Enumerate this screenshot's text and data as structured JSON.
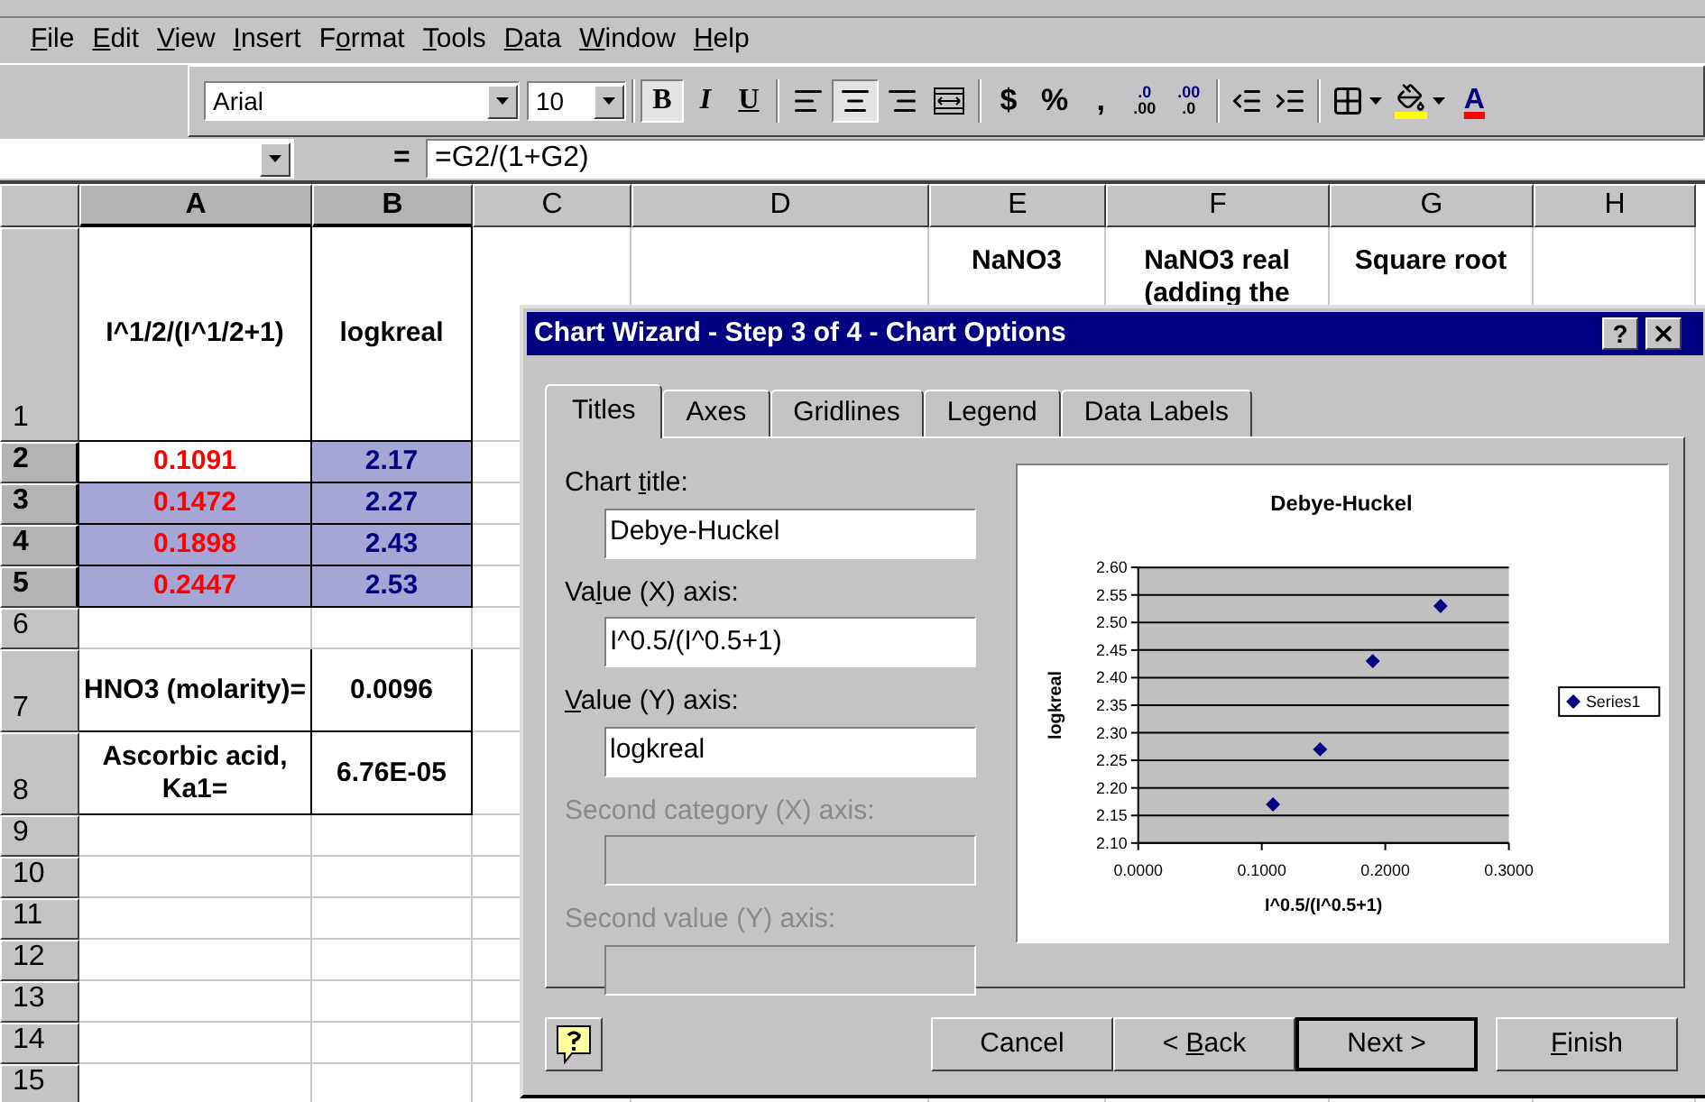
{
  "menu": [
    {
      "key": "F",
      "post": "ile"
    },
    {
      "key": "E",
      "post": "dit"
    },
    {
      "key": "V",
      "post": "iew"
    },
    {
      "key": "I",
      "post": "nsert"
    },
    {
      "pre": "F",
      "key": "o",
      "post": "rmat"
    },
    {
      "key": "T",
      "post": "ools"
    },
    {
      "key": "D",
      "post": "ata"
    },
    {
      "key": "W",
      "post": "indow"
    },
    {
      "key": "H",
      "post": "elp"
    }
  ],
  "toolbar": [
    {
      "kind": "font",
      "value": "Arial"
    },
    {
      "kind": "size",
      "value": "10"
    },
    {
      "kind": "sep"
    },
    {
      "kind": "bold",
      "label": "B",
      "selected": true
    },
    {
      "kind": "italic",
      "label": "I",
      "selected": false
    },
    {
      "kind": "underline",
      "label": "U",
      "selected": false
    },
    {
      "kind": "sep"
    },
    {
      "kind": "align-left",
      "selected": false
    },
    {
      "kind": "align-center",
      "selected": true
    },
    {
      "kind": "align-right",
      "selected": false
    },
    {
      "kind": "merge",
      "selected": false
    },
    {
      "kind": "sep"
    },
    {
      "kind": "symbol",
      "label": "$"
    },
    {
      "kind": "symbol",
      "label": "%"
    },
    {
      "kind": "symbol",
      "label": ","
    },
    {
      "kind": "decimal-up",
      "top": ".0",
      "bottom": ".00"
    },
    {
      "kind": "decimal-down",
      "top": ".00",
      "bottom": ".0"
    },
    {
      "kind": "sep"
    },
    {
      "kind": "indent-less"
    },
    {
      "kind": "indent-more"
    },
    {
      "kind": "sep"
    },
    {
      "kind": "borders"
    },
    {
      "kind": "fill"
    },
    {
      "kind": "font-color",
      "label": "A"
    }
  ],
  "formula_bar": {
    "equals": "=",
    "formula": "=G2/(1+G2)"
  },
  "sheet": {
    "columns": [
      {
        "label": "A",
        "selected": true
      },
      {
        "label": "B",
        "selected": true
      },
      {
        "label": "C",
        "selected": false
      },
      {
        "label": "D",
        "selected": false
      },
      {
        "label": "E",
        "selected": false
      },
      {
        "label": "F",
        "selected": false
      },
      {
        "label": "G",
        "selected": false
      },
      {
        "label": "H",
        "selected": false
      }
    ],
    "rows": [
      {
        "number": "1",
        "kind": "header",
        "selected": false,
        "cells": [
          {
            "text": "I^1/2/(I^1/2+1)",
            "boxed": true
          },
          {
            "text": "logkreal",
            "boxed": true
          },
          null,
          null,
          {
            "text": "NaNO3",
            "top": true
          },
          {
            "text": "NaNO3 real (adding the",
            "top": true
          },
          {
            "text": "Square root",
            "top": true
          },
          null
        ]
      },
      {
        "number": "2",
        "kind": "data",
        "selected": true,
        "cells": [
          {
            "text": "0.1091",
            "color": "#ff0000",
            "boxed": true,
            "selected": false
          },
          {
            "text": "2.17",
            "color": "#000080",
            "boxed": true,
            "selected": true
          },
          null,
          null,
          null,
          null,
          null,
          null
        ]
      },
      {
        "number": "3",
        "kind": "data",
        "selected": true,
        "cells": [
          {
            "text": "0.1472",
            "color": "#ff0000",
            "boxed": true,
            "selected": true
          },
          {
            "text": "2.27",
            "color": "#000080",
            "boxed": true,
            "selected": true
          },
          null,
          null,
          null,
          null,
          null,
          null
        ]
      },
      {
        "number": "4",
        "kind": "data",
        "selected": true,
        "cells": [
          {
            "text": "0.1898",
            "color": "#ff0000",
            "boxed": true,
            "selected": true
          },
          {
            "text": "2.43",
            "color": "#000080",
            "boxed": true,
            "selected": true
          },
          null,
          null,
          null,
          null,
          null,
          null
        ]
      },
      {
        "number": "5",
        "kind": "data",
        "selected": true,
        "cells": [
          {
            "text": "0.2447",
            "color": "#ff0000",
            "boxed": true,
            "selected": true
          },
          {
            "text": "2.53",
            "color": "#000080",
            "boxed": true,
            "selected": true
          },
          null,
          null,
          null,
          null,
          null,
          null
        ]
      },
      {
        "number": "6",
        "kind": "data",
        "selected": false,
        "cells": []
      },
      {
        "number": "7",
        "kind": "double",
        "selected": false,
        "cells": [
          {
            "text": "HNO3 (molarity)=",
            "boxed": true
          },
          {
            "text": "0.0096",
            "boxed": true
          }
        ]
      },
      {
        "number": "8",
        "kind": "double",
        "selected": false,
        "cells": [
          {
            "text": "Ascorbic acid, Ka1=",
            "boxed": true
          },
          {
            "text": "6.76E-05",
            "boxed": true
          }
        ]
      },
      {
        "number": "9",
        "kind": "data",
        "selected": false,
        "cells": []
      },
      {
        "number": "10",
        "kind": "data",
        "selected": false,
        "cells": []
      },
      {
        "number": "11",
        "kind": "data",
        "selected": false,
        "cells": []
      },
      {
        "number": "12",
        "kind": "data",
        "selected": false,
        "cells": []
      },
      {
        "number": "13",
        "kind": "data",
        "selected": false,
        "cells": []
      },
      {
        "number": "14",
        "kind": "data",
        "selected": false,
        "cells": []
      },
      {
        "number": "15",
        "kind": "data",
        "selected": false,
        "cells": []
      }
    ]
  },
  "dialog": {
    "title": "Chart Wizard - Step 3 of 4 - Chart Options",
    "help": "?",
    "tabs": [
      {
        "label": "Titles",
        "selected": true
      },
      {
        "label": "Axes",
        "selected": false
      },
      {
        "label": "Gridlines",
        "selected": false
      },
      {
        "label": "Legend",
        "selected": false
      },
      {
        "label": "Data Labels",
        "selected": false
      }
    ],
    "fields": [
      {
        "label": {
          "pre": "Chart ",
          "key": "t",
          "post": "itle:"
        },
        "value": "Debye-Huckel",
        "disabled": false
      },
      {
        "label": {
          "pre": "Va",
          "key": "l",
          "post": "ue (X) axis:"
        },
        "value": "I^0.5/(I^0.5+1)",
        "disabled": false
      },
      {
        "label": {
          "key": "V",
          "post": "alue (Y) axis:"
        },
        "value": "logkreal",
        "disabled": false
      },
      {
        "label": {
          "pre": "Second category (X) axis:"
        },
        "disabled": true
      },
      {
        "label": {
          "pre": "Second value (Y) axis:"
        },
        "disabled": true
      }
    ],
    "preview": {
      "chart_data": {
        "type": "scatter",
        "grid": true,
        "title": "Debye-Huckel",
        "xlabel": "I^0.5/(I^0.5+1)",
        "ylabel": "logkreal",
        "x": [
          0.1091,
          0.1472,
          0.1898,
          0.2447
        ],
        "series": [
          {
            "name": "Series1",
            "color": "#000080",
            "values": [
              2.17,
              2.27,
              2.43,
              2.53
            ]
          }
        ],
        "xlim": [
          0,
          0.3
        ],
        "ylim": [
          2.1,
          2.6
        ],
        "xticks": [
          {
            "value": 0,
            "label": "0.0000"
          },
          {
            "value": 0.1,
            "label": "0.1000"
          },
          {
            "value": 0.2,
            "label": "0.2000"
          },
          {
            "value": 0.3,
            "label": "0.3000"
          }
        ],
        "yticks": [
          {
            "value": 2.1,
            "label": "2.10"
          },
          {
            "value": 2.15,
            "label": "2.15"
          },
          {
            "value": 2.2,
            "label": "2.20"
          },
          {
            "value": 2.25,
            "label": "2.25"
          },
          {
            "value": 2.3,
            "label": "2.30"
          },
          {
            "value": 2.35,
            "label": "2.35"
          },
          {
            "value": 2.4,
            "label": "2.40"
          },
          {
            "value": 2.45,
            "label": "2.45"
          },
          {
            "value": 2.5,
            "label": "2.50"
          },
          {
            "value": 2.55,
            "label": "2.55"
          },
          {
            "value": 2.6,
            "label": "2.60"
          }
        ]
      }
    },
    "buttons": [
      {
        "pre": "Cancel",
        "default": false
      },
      {
        "pre": "< ",
        "key": "B",
        "post": "ack",
        "default": false
      },
      {
        "pre": "Next >",
        "default": true
      },
      {
        "key": "F",
        "post": "inish",
        "default": false
      }
    ]
  }
}
